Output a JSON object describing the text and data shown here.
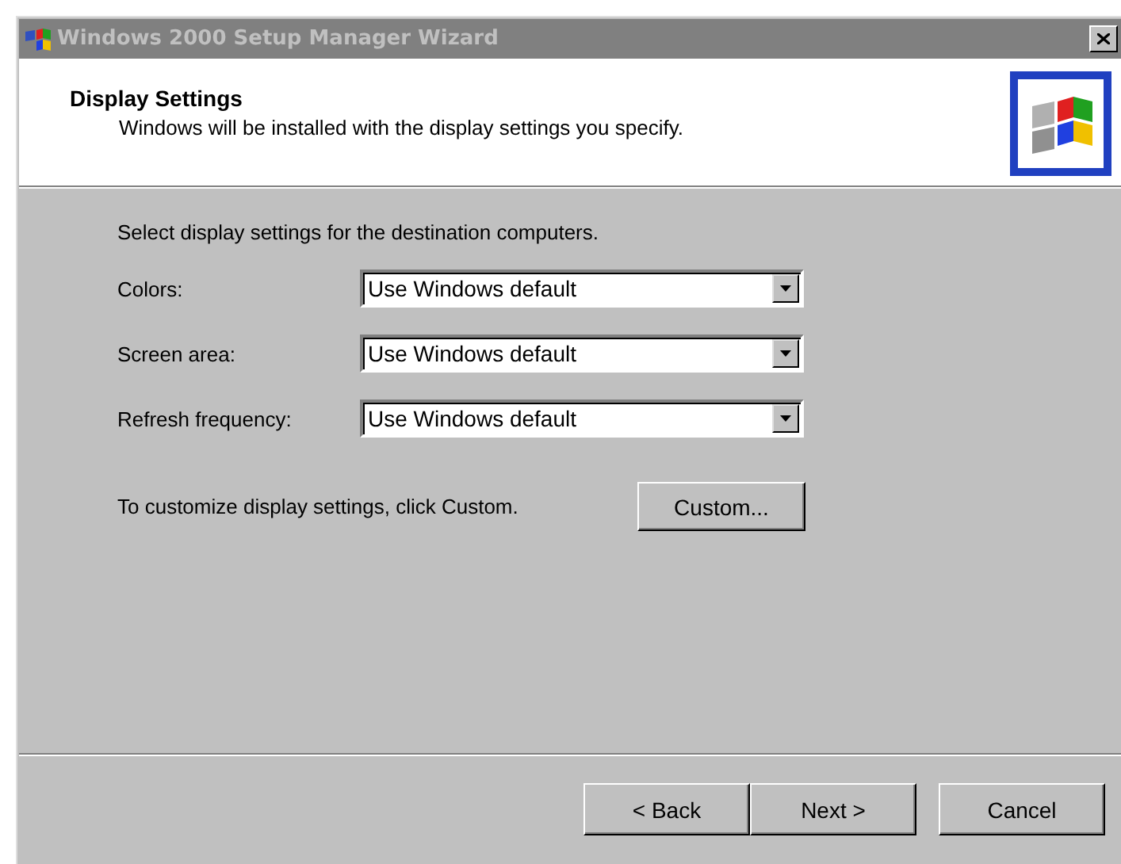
{
  "window": {
    "title": "Windows 2000 Setup Manager Wizard",
    "active": false
  },
  "header": {
    "title": "Display Settings",
    "subtitle": "Windows will be installed with the display settings you specify."
  },
  "intro": "Select display settings for the destination computers.",
  "settings": [
    {
      "label": "Colors:",
      "value": "Use Windows default"
    },
    {
      "label": "Screen area:",
      "value": "Use Windows default"
    },
    {
      "label": "Refresh frequency:",
      "value": "Use Windows default"
    }
  ],
  "custom": {
    "text": "To customize display settings, click Custom.",
    "button": "Custom..."
  },
  "buttons": [
    "< Back",
    "Next >",
    "Cancel"
  ]
}
